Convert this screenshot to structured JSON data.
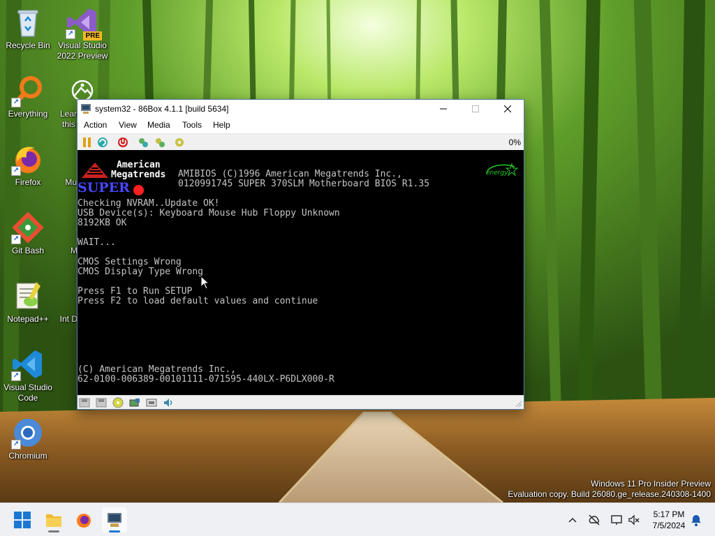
{
  "desktop": {
    "icons": [
      {
        "label": "Recycle Bin",
        "icon": "recycle-bin-icon"
      },
      {
        "label": "Visual Studio 2022 Preview",
        "badge": "PRE",
        "icon": "visual-studio-icon"
      },
      {
        "label": "Everything",
        "icon": "everything-search-icon"
      },
      {
        "label": "Learn about this picture",
        "icon": "learn-picture-icon"
      },
      {
        "label": "Firefox",
        "icon": "firefox-icon"
      },
      {
        "label": "Multi",
        "icon": "multi-icon"
      },
      {
        "label": "Git Bash",
        "icon": "git-bash-icon"
      },
      {
        "label": "M",
        "icon": "m-icon"
      },
      {
        "label": "Notepad++",
        "icon": "notepadpp-icon"
      },
      {
        "label": "Int Dow",
        "icon": "int-dow-icon"
      },
      {
        "label": "Visual Studio Code",
        "icon": "vscode-icon"
      },
      {
        "label": "Chromium",
        "icon": "chromium-icon"
      }
    ],
    "watermark": {
      "line1": "Windows 11 Pro Insider Preview",
      "line2": "Evaluation copy. Build 26080.ge_release.240308-1400"
    }
  },
  "window": {
    "title": "system32 - 86Box 4.1.1 [build 5634]",
    "menu": [
      "Action",
      "View",
      "Media",
      "Tools",
      "Help"
    ],
    "toolbar_percent": "0%",
    "bios": {
      "logo_line1": "American",
      "logo_line2": "Megatrends",
      "header1": "AMIBIOS (C)1996 American Megatrends Inc.,",
      "header2": "0120991745 SUPER 370SLM Motherboard BIOS R1.35",
      "super_text": "SUPER",
      "energy_text": "energy",
      "lines": [
        "Checking NVRAM..Update OK!",
        "USB Device(s): Keyboard Mouse Hub Floppy Unknown",
        "8192KB OK",
        "WAIT...",
        "CMOS Settings Wrong",
        "CMOS Display Type Wrong",
        "Press F1 to Run SETUP",
        "Press F2 to load default values and continue"
      ],
      "footer1": "(C) American Megatrends Inc.,",
      "footer2": "62-0100-006389-00101111-071595-440LX-P6DLX000-R"
    }
  },
  "taskbar": {
    "clock_time": "5:17 PM",
    "clock_date": "7/5/2024"
  },
  "colors": {
    "bios_text": "#c4c4c4",
    "super_blue": "#4848ff",
    "energy_green": "#22cc22",
    "taskbar_bg": "#eef0f3"
  }
}
